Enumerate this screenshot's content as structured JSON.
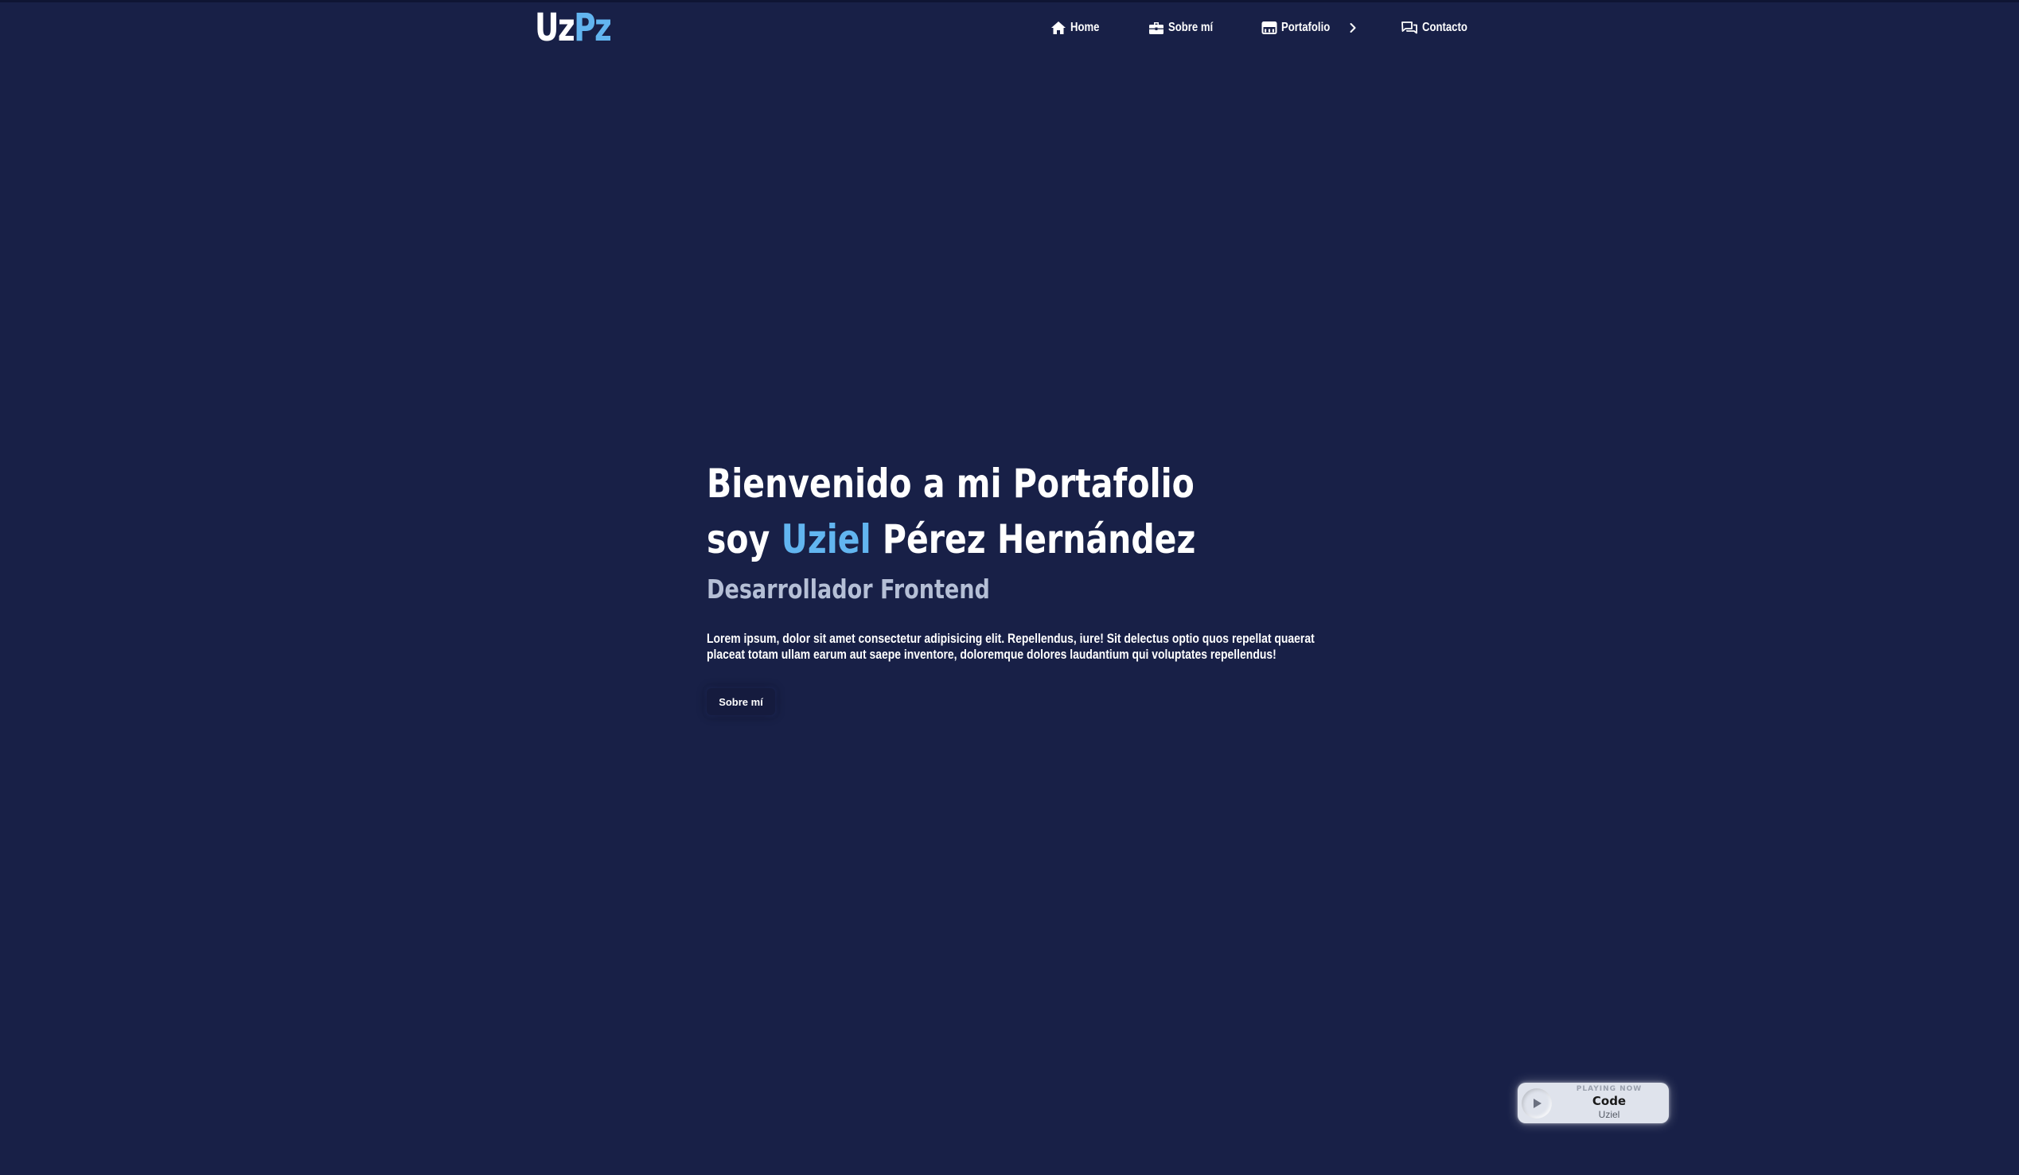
{
  "header": {
    "logo_part1": "Uz",
    "logo_part2": "Pz",
    "nav": {
      "home": {
        "label": "Home",
        "icon": "home-icon"
      },
      "about": {
        "label": "Sobre mí",
        "icon": "briefcase-icon"
      },
      "portfolio": {
        "label": "Portafolio",
        "icon": "store-icon",
        "expand_icon": "chevron-right-icon"
      },
      "contact": {
        "label": "Contacto",
        "icon": "chat-icon"
      }
    }
  },
  "hero": {
    "title_line1": "Bienvenido a mi Portafolio",
    "title_line2_prefix": "soy ",
    "title_highlight": "Uziel",
    "title_line2_suffix": " Pérez Hernández",
    "subtitle": "Desarrollador Frontend",
    "description": "Lorem ipsum, dolor sit amet consectetur adipisicing elit. Repellendus, iure! Sit delectus optio quos repellat quaerat placeat totam ullam earum aut saepe inventore, doloremque dolores laudantium qui voluptates repellendus!",
    "button_label": "Sobre mí"
  },
  "player": {
    "status": "PLAYING NOW",
    "track": "Code",
    "artist": "Uziel",
    "icon": "play-icon"
  },
  "colors": {
    "background": "#182047",
    "accent": "#62b5f0",
    "subtitle": "#b5bfd6",
    "player_bg": "#dfe3ec"
  }
}
